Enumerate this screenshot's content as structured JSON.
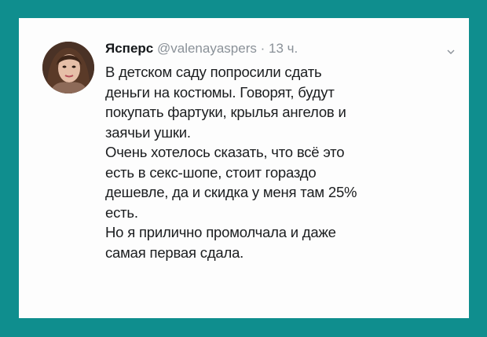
{
  "tweet": {
    "author_name": "Ясперс",
    "handle": "@valenayaspers",
    "separator": "·",
    "time": "13 ч.",
    "avatar_icon": "user-avatar-photo",
    "menu_icon": "chevron-down-icon",
    "lines": [
      "В детском саду попросили сдать",
      "деньги на костюмы. Говорят, будут",
      "покупать фартуки, крылья ангелов и",
      "заячьи ушки.",
      "Очень хотелось сказать, что всё  это",
      "есть в секс-шопе, стоит гораздо",
      "дешевле, да и скидка у меня там 25%",
      "есть.",
      "Но я прилично промолчала и даже",
      "самая первая сдала."
    ]
  },
  "colors": {
    "frame": "#0f8e8e",
    "card": "#fdfdfd",
    "text": "#1b1d1f",
    "muted": "#8a9198"
  }
}
